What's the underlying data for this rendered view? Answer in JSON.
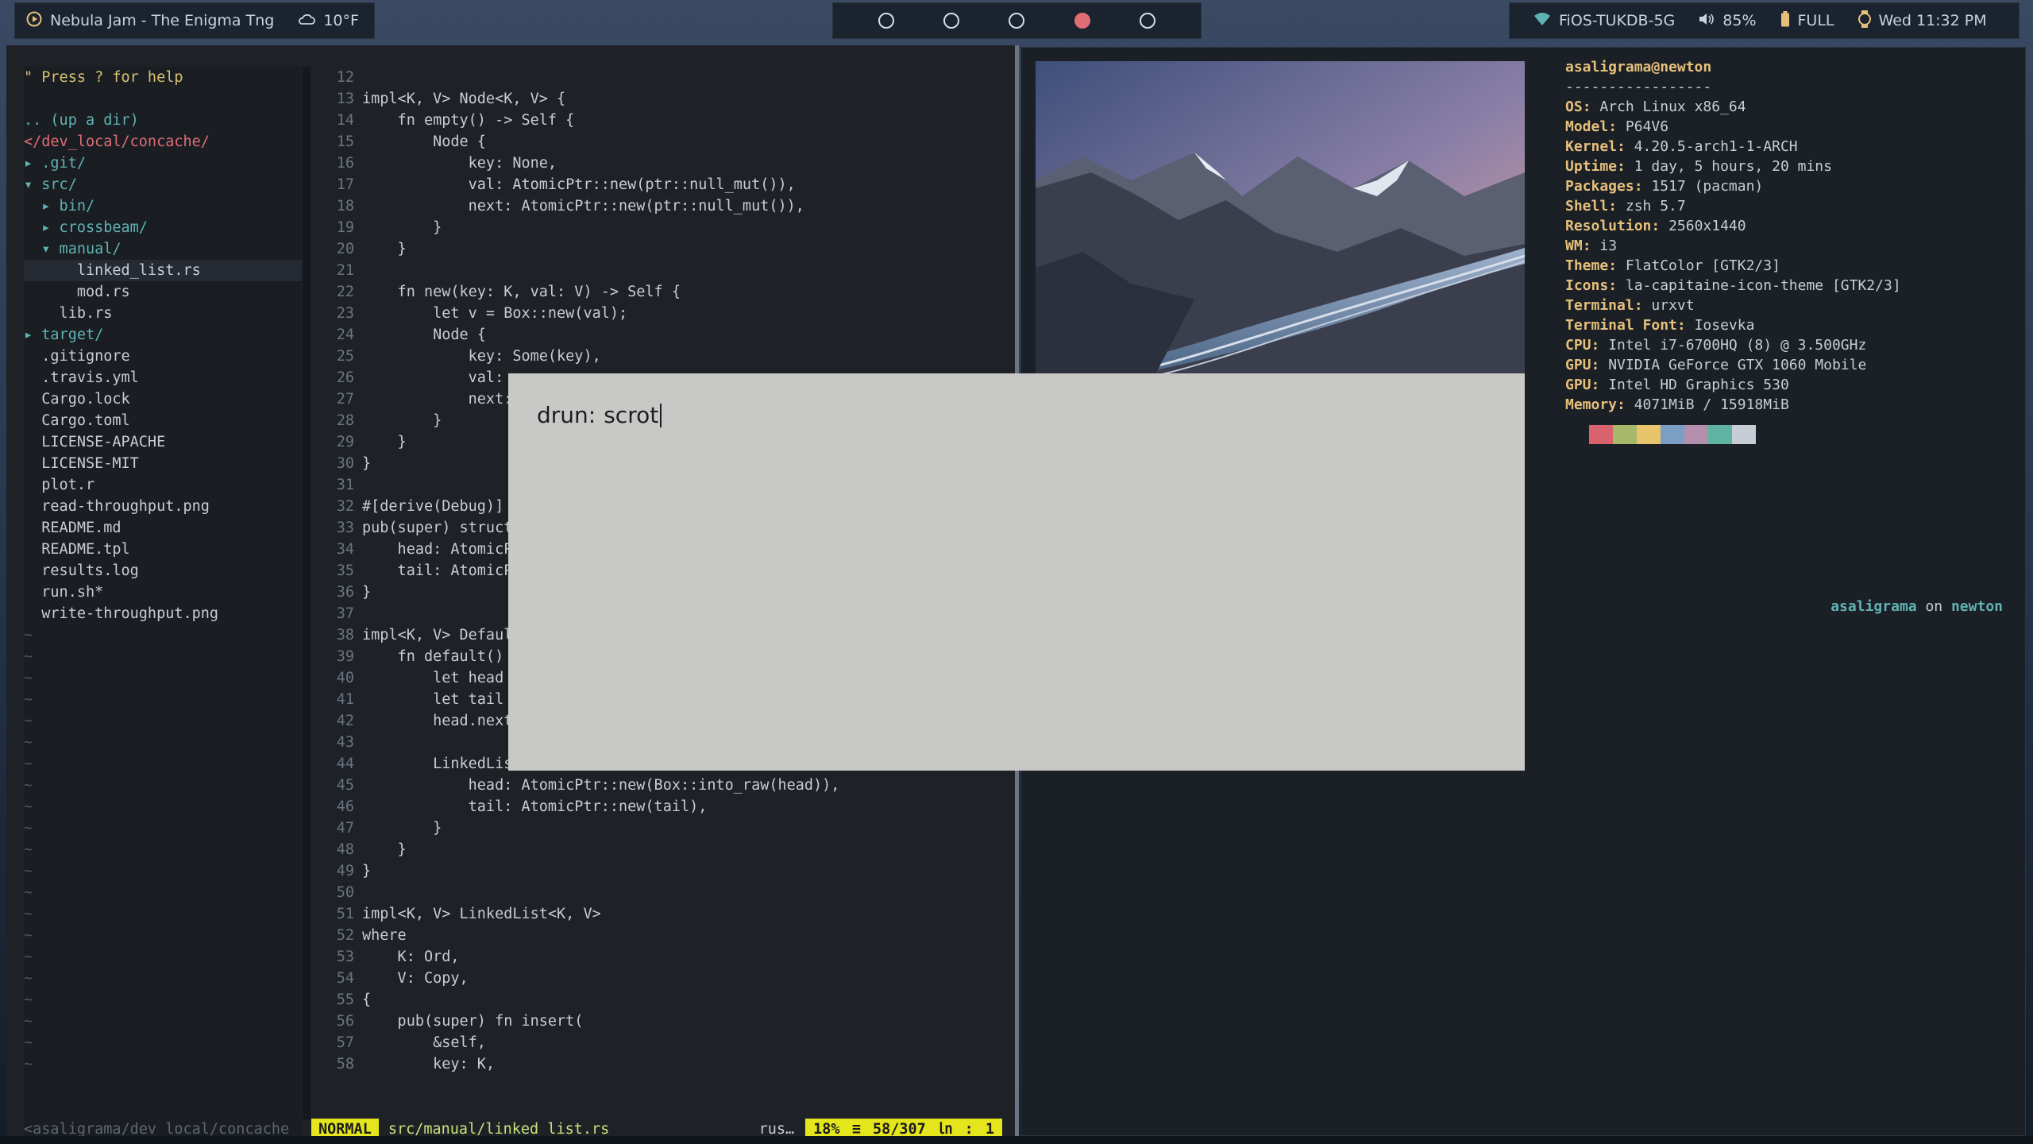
{
  "topbar": {
    "player": "Nebula Jam - The Enigma Tng",
    "weather": "10°F",
    "workspaces": [
      false,
      false,
      false,
      true,
      false
    ],
    "wifi": "FiOS-TUKDB-5G",
    "volume": "85%",
    "battery": "FULL",
    "clock": "Wed 11:32 PM"
  },
  "tree": {
    "help": "\" Press ? for help",
    "updir": ".. (up a dir)",
    "path": "</dev_local/concache/",
    "items": [
      {
        "label": "▸ .git/",
        "type": "dir"
      },
      {
        "label": "▾ src/",
        "type": "dir"
      },
      {
        "label": "  ▸ bin/",
        "type": "dir"
      },
      {
        "label": "  ▸ crossbeam/",
        "type": "dir"
      },
      {
        "label": "  ▾ manual/",
        "type": "dir"
      },
      {
        "label": "      linked_list.rs",
        "type": "file",
        "selected": true
      },
      {
        "label": "      mod.rs",
        "type": "file"
      },
      {
        "label": "    lib.rs",
        "type": "file"
      },
      {
        "label": "▸ target/",
        "type": "dir"
      },
      {
        "label": "  .gitignore",
        "type": "file"
      },
      {
        "label": "  .travis.yml",
        "type": "file"
      },
      {
        "label": "  Cargo.lock",
        "type": "file"
      },
      {
        "label": "  Cargo.toml",
        "type": "file"
      },
      {
        "label": "  LICENSE-APACHE",
        "type": "file"
      },
      {
        "label": "  LICENSE-MIT",
        "type": "file"
      },
      {
        "label": "  plot.r",
        "type": "file"
      },
      {
        "label": "  read-throughput.png",
        "type": "file"
      },
      {
        "label": "  README.md",
        "type": "file"
      },
      {
        "label": "  README.tpl",
        "type": "file"
      },
      {
        "label": "  results.log",
        "type": "file"
      },
      {
        "label": "  run.sh*",
        "type": "file"
      },
      {
        "label": "  write-throughput.png",
        "type": "file"
      }
    ],
    "tilde_count": 21,
    "status": "<asaligrama/dev_local/concache"
  },
  "code": [
    {
      "n": "12",
      "t": ""
    },
    {
      "n": "13",
      "t": "impl<K, V> Node<K, V> {"
    },
    {
      "n": "14",
      "t": "    fn empty() -> Self {"
    },
    {
      "n": "15",
      "t": "        Node {"
    },
    {
      "n": "16",
      "t": "            key: None,"
    },
    {
      "n": "17",
      "t": "            val: AtomicPtr::new(ptr::null_mut()),"
    },
    {
      "n": "18",
      "t": "            next: AtomicPtr::new(ptr::null_mut()),"
    },
    {
      "n": "19",
      "t": "        }"
    },
    {
      "n": "20",
      "t": "    }"
    },
    {
      "n": "21",
      "t": ""
    },
    {
      "n": "22",
      "t": "    fn new(key: K, val: V) -> Self {"
    },
    {
      "n": "23",
      "t": "        let v = Box::new(val);"
    },
    {
      "n": "24",
      "t": "        Node {"
    },
    {
      "n": "25",
      "t": "            key: Some(key),"
    },
    {
      "n": "26",
      "t": "            val:"
    },
    {
      "n": "27",
      "t": "            next:"
    },
    {
      "n": "28",
      "t": "        }"
    },
    {
      "n": "29",
      "t": "    }"
    },
    {
      "n": "30",
      "t": "}"
    },
    {
      "n": "31",
      "t": ""
    },
    {
      "n": "32",
      "t": "#[derive(Debug)]"
    },
    {
      "n": "33",
      "t": "pub(super) struct"
    },
    {
      "n": "34",
      "t": "    head: AtomicP"
    },
    {
      "n": "35",
      "t": "    tail: AtomicP"
    },
    {
      "n": "36",
      "t": "}"
    },
    {
      "n": "37",
      "t": ""
    },
    {
      "n": "38",
      "t": "impl<K, V> Defaul"
    },
    {
      "n": "39",
      "t": "    fn default()"
    },
    {
      "n": "40",
      "t": "        let head"
    },
    {
      "n": "41",
      "t": "        let tail"
    },
    {
      "n": "42",
      "t": "        head.next"
    },
    {
      "n": "43",
      "t": ""
    },
    {
      "n": "44",
      "t": "        LinkedList"
    },
    {
      "n": "45",
      "t": "            head: AtomicPtr::new(Box::into_raw(head)),"
    },
    {
      "n": "46",
      "t": "            tail: AtomicPtr::new(tail),"
    },
    {
      "n": "47",
      "t": "        }"
    },
    {
      "n": "48",
      "t": "    }"
    },
    {
      "n": "49",
      "t": "}"
    },
    {
      "n": "50",
      "t": ""
    },
    {
      "n": "51",
      "t": "impl<K, V> LinkedList<K, V>"
    },
    {
      "n": "52",
      "t": "where"
    },
    {
      "n": "53",
      "t": "    K: Ord,"
    },
    {
      "n": "54",
      "t": "    V: Copy,"
    },
    {
      "n": "55",
      "t": "{"
    },
    {
      "n": "56",
      "t": "    pub(super) fn insert("
    },
    {
      "n": "57",
      "t": "        &self,"
    },
    {
      "n": "58",
      "t": "        key: K,"
    }
  ],
  "status": {
    "mode": "NORMAL",
    "file": "src/manual/linked_list.rs",
    "filetype": "rus…",
    "position": "18% ≡   58/307 ㏑ :  1"
  },
  "neofetch": {
    "header": "asaligrama@newton",
    "underline": "-----------------",
    "rows": [
      {
        "k": "OS",
        "v": "Arch Linux x86_64"
      },
      {
        "k": "Model",
        "v": "P64V6"
      },
      {
        "k": "Kernel",
        "v": "4.20.5-arch1-1-ARCH"
      },
      {
        "k": "Uptime",
        "v": "1 day, 5 hours, 20 mins"
      },
      {
        "k": "Packages",
        "v": "1517 (pacman)"
      },
      {
        "k": "Shell",
        "v": "zsh 5.7"
      },
      {
        "k": "Resolution",
        "v": "2560x1440"
      },
      {
        "k": "WM",
        "v": "i3"
      },
      {
        "k": "Theme",
        "v": "FlatColor [GTK2/3]"
      },
      {
        "k": "Icons",
        "v": "la-capitaine-icon-theme [GTK2/3]"
      },
      {
        "k": "Terminal",
        "v": "urxvt"
      },
      {
        "k": "Terminal Font",
        "v": "Iosevka"
      },
      {
        "k": "CPU",
        "v": "Intel i7-6700HQ (8) @ 3.500GHz"
      },
      {
        "k": "GPU",
        "v": "NVIDIA GeForce GTX 1060 Mobile"
      },
      {
        "k": "GPU",
        "v": "Intel HD Graphics 530"
      },
      {
        "k": "Memory",
        "v": "4071MiB / 15918MiB"
      }
    ],
    "swatches": [
      "#d9636c",
      "#a8b86a",
      "#e8c46b",
      "#7a9ec4",
      "#b48ead",
      "#5fb3a1",
      "#c8ccd4"
    ],
    "prompt_user": "asaligrama",
    "prompt_on": "on",
    "prompt_host": "newton"
  },
  "rofi": {
    "prompt": "drun:",
    "input": "scrot"
  }
}
